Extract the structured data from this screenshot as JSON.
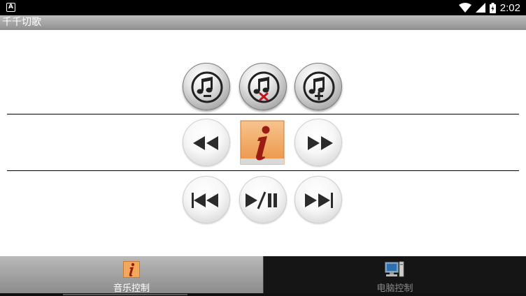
{
  "status_bar": {
    "app_badge": "A",
    "time": "2:02"
  },
  "app": {
    "title": "千千切歌"
  },
  "controls": {
    "row1": [
      "volume-down",
      "mute",
      "volume-up"
    ],
    "row2": [
      "rewind",
      "info",
      "fast-forward"
    ],
    "row3": [
      "previous-track",
      "play-pause",
      "next-track"
    ]
  },
  "tabs": [
    {
      "label": "音乐控制",
      "icon": "info-icon",
      "active": true
    },
    {
      "label": "电脑控制",
      "icon": "computer-icon",
      "active": false
    }
  ],
  "colors": {
    "mute_x": "#c0151a",
    "info_bg": "#f0a45c",
    "info_letter": "#9b1c13"
  }
}
